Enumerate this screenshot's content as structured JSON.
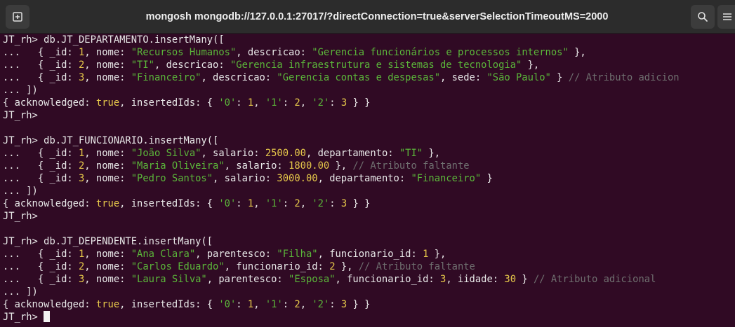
{
  "window": {
    "title": "mongosh mongodb://127.0.0.1:27017/?directConnection=true&serverSelectionTimeoutMS=2000",
    "icons": {
      "new_tab": "new-tab-icon",
      "search": "search-icon",
      "menu": "hamburger-menu-icon"
    }
  },
  "colors": {
    "background": "#300a24",
    "text": "#e8e8e8",
    "string": "#5bb73a",
    "number": "#e6c84a",
    "comment": "#6f6f6f"
  },
  "terminal": {
    "lines": [
      [
        {
          "t": "JT_rh> db.JT_DEPARTAMENTO.insertMany([",
          "c": "default"
        }
      ],
      [
        {
          "t": "...   { ",
          "c": "default"
        },
        {
          "t": "_id",
          "c": "default"
        },
        {
          "t": ": ",
          "c": "default"
        },
        {
          "t": "1",
          "c": "num"
        },
        {
          "t": ", nome: ",
          "c": "default"
        },
        {
          "t": "\"Recursos Humanos\"",
          "c": "str"
        },
        {
          "t": ", descricao: ",
          "c": "default"
        },
        {
          "t": "\"Gerencia funcionários e processos internos\"",
          "c": "str"
        },
        {
          "t": " },",
          "c": "default"
        }
      ],
      [
        {
          "t": "...   { _id: ",
          "c": "default"
        },
        {
          "t": "2",
          "c": "num"
        },
        {
          "t": ", nome: ",
          "c": "default"
        },
        {
          "t": "\"TI\"",
          "c": "str"
        },
        {
          "t": ", descricao: ",
          "c": "default"
        },
        {
          "t": "\"Gerencia infraestrutura e sistemas de tecnologia\"",
          "c": "str"
        },
        {
          "t": " },",
          "c": "default"
        }
      ],
      [
        {
          "t": "...   { _id: ",
          "c": "default"
        },
        {
          "t": "3",
          "c": "num"
        },
        {
          "t": ", nome: ",
          "c": "default"
        },
        {
          "t": "\"Financeiro\"",
          "c": "str"
        },
        {
          "t": ", descricao: ",
          "c": "default"
        },
        {
          "t": "\"Gerencia contas e despesas\"",
          "c": "str"
        },
        {
          "t": ", sede: ",
          "c": "default"
        },
        {
          "t": "\"São Paulo\"",
          "c": "str"
        },
        {
          "t": " } ",
          "c": "default"
        },
        {
          "t": "// Atributo adicion",
          "c": "comment"
        }
      ],
      [
        {
          "t": "... ])",
          "c": "default"
        }
      ],
      [
        {
          "t": "{ acknowledged: ",
          "c": "default"
        },
        {
          "t": "true",
          "c": "bool"
        },
        {
          "t": ", insertedIds: { ",
          "c": "default"
        },
        {
          "t": "'0'",
          "c": "str"
        },
        {
          "t": ": ",
          "c": "default"
        },
        {
          "t": "1",
          "c": "num"
        },
        {
          "t": ", ",
          "c": "default"
        },
        {
          "t": "'1'",
          "c": "str"
        },
        {
          "t": ": ",
          "c": "default"
        },
        {
          "t": "2",
          "c": "num"
        },
        {
          "t": ", ",
          "c": "default"
        },
        {
          "t": "'2'",
          "c": "str"
        },
        {
          "t": ": ",
          "c": "default"
        },
        {
          "t": "3",
          "c": "num"
        },
        {
          "t": " } }",
          "c": "default"
        }
      ],
      [
        {
          "t": "JT_rh>",
          "c": "default"
        }
      ],
      [
        {
          "t": "",
          "c": "default"
        }
      ],
      [
        {
          "t": "JT_rh> db.JT_FUNCIONARIO.insertMany([",
          "c": "default"
        }
      ],
      [
        {
          "t": "...   { _id: ",
          "c": "default"
        },
        {
          "t": "1",
          "c": "num"
        },
        {
          "t": ", nome: ",
          "c": "default"
        },
        {
          "t": "\"João Silva\"",
          "c": "str"
        },
        {
          "t": ", salario: ",
          "c": "default"
        },
        {
          "t": "2500.00",
          "c": "num"
        },
        {
          "t": ", departamento: ",
          "c": "default"
        },
        {
          "t": "\"TI\"",
          "c": "str"
        },
        {
          "t": " },",
          "c": "default"
        }
      ],
      [
        {
          "t": "...   { _id: ",
          "c": "default"
        },
        {
          "t": "2",
          "c": "num"
        },
        {
          "t": ", nome: ",
          "c": "default"
        },
        {
          "t": "\"Maria Oliveira\"",
          "c": "str"
        },
        {
          "t": ", salario: ",
          "c": "default"
        },
        {
          "t": "1800.00",
          "c": "num"
        },
        {
          "t": " }, ",
          "c": "default"
        },
        {
          "t": "// Atributo faltante",
          "c": "comment"
        }
      ],
      [
        {
          "t": "...   { _id: ",
          "c": "default"
        },
        {
          "t": "3",
          "c": "num"
        },
        {
          "t": ", nome: ",
          "c": "default"
        },
        {
          "t": "\"Pedro Santos\"",
          "c": "str"
        },
        {
          "t": ", salario: ",
          "c": "default"
        },
        {
          "t": "3000.00",
          "c": "num"
        },
        {
          "t": ", departamento: ",
          "c": "default"
        },
        {
          "t": "\"Financeiro\"",
          "c": "str"
        },
        {
          "t": " }",
          "c": "default"
        }
      ],
      [
        {
          "t": "... ])",
          "c": "default"
        }
      ],
      [
        {
          "t": "{ acknowledged: ",
          "c": "default"
        },
        {
          "t": "true",
          "c": "bool"
        },
        {
          "t": ", insertedIds: { ",
          "c": "default"
        },
        {
          "t": "'0'",
          "c": "str"
        },
        {
          "t": ": ",
          "c": "default"
        },
        {
          "t": "1",
          "c": "num"
        },
        {
          "t": ", ",
          "c": "default"
        },
        {
          "t": "'1'",
          "c": "str"
        },
        {
          "t": ": ",
          "c": "default"
        },
        {
          "t": "2",
          "c": "num"
        },
        {
          "t": ", ",
          "c": "default"
        },
        {
          "t": "'2'",
          "c": "str"
        },
        {
          "t": ": ",
          "c": "default"
        },
        {
          "t": "3",
          "c": "num"
        },
        {
          "t": " } }",
          "c": "default"
        }
      ],
      [
        {
          "t": "JT_rh>",
          "c": "default"
        }
      ],
      [
        {
          "t": "",
          "c": "default"
        }
      ],
      [
        {
          "t": "JT_rh> db.JT_DEPENDENTE.insertMany([",
          "c": "default"
        }
      ],
      [
        {
          "t": "...   { _id: ",
          "c": "default"
        },
        {
          "t": "1",
          "c": "num"
        },
        {
          "t": ", nome: ",
          "c": "default"
        },
        {
          "t": "\"Ana Clara\"",
          "c": "str"
        },
        {
          "t": ", parentesco: ",
          "c": "default"
        },
        {
          "t": "\"Filha\"",
          "c": "str"
        },
        {
          "t": ", funcionario_id: ",
          "c": "default"
        },
        {
          "t": "1",
          "c": "num"
        },
        {
          "t": " },",
          "c": "default"
        }
      ],
      [
        {
          "t": "...   { _id: ",
          "c": "default"
        },
        {
          "t": "2",
          "c": "num"
        },
        {
          "t": ", nome: ",
          "c": "default"
        },
        {
          "t": "\"Carlos Eduardo\"",
          "c": "str"
        },
        {
          "t": ", funcionario_id: ",
          "c": "default"
        },
        {
          "t": "2",
          "c": "num"
        },
        {
          "t": " }, ",
          "c": "default"
        },
        {
          "t": "// Atributo faltante",
          "c": "comment"
        }
      ],
      [
        {
          "t": "...   { _id: ",
          "c": "default"
        },
        {
          "t": "3",
          "c": "num"
        },
        {
          "t": ", nome: ",
          "c": "default"
        },
        {
          "t": "\"Laura Silva\"",
          "c": "str"
        },
        {
          "t": ", parentesco: ",
          "c": "default"
        },
        {
          "t": "\"Esposa\"",
          "c": "str"
        },
        {
          "t": ", funcionario_id: ",
          "c": "default"
        },
        {
          "t": "3",
          "c": "num"
        },
        {
          "t": ", iidade: ",
          "c": "default"
        },
        {
          "t": "30",
          "c": "num"
        },
        {
          "t": " } ",
          "c": "default"
        },
        {
          "t": "// Atributo adicional",
          "c": "comment"
        }
      ],
      [
        {
          "t": "... ])",
          "c": "default"
        }
      ],
      [
        {
          "t": "{ acknowledged: ",
          "c": "default"
        },
        {
          "t": "true",
          "c": "bool"
        },
        {
          "t": ", insertedIds: { ",
          "c": "default"
        },
        {
          "t": "'0'",
          "c": "str"
        },
        {
          "t": ": ",
          "c": "default"
        },
        {
          "t": "1",
          "c": "num"
        },
        {
          "t": ", ",
          "c": "default"
        },
        {
          "t": "'1'",
          "c": "str"
        },
        {
          "t": ": ",
          "c": "default"
        },
        {
          "t": "2",
          "c": "num"
        },
        {
          "t": ", ",
          "c": "default"
        },
        {
          "t": "'2'",
          "c": "str"
        },
        {
          "t": ": ",
          "c": "default"
        },
        {
          "t": "3",
          "c": "num"
        },
        {
          "t": " } }",
          "c": "default"
        }
      ],
      [
        {
          "t": "JT_rh> ",
          "c": "default"
        }
      ]
    ]
  }
}
